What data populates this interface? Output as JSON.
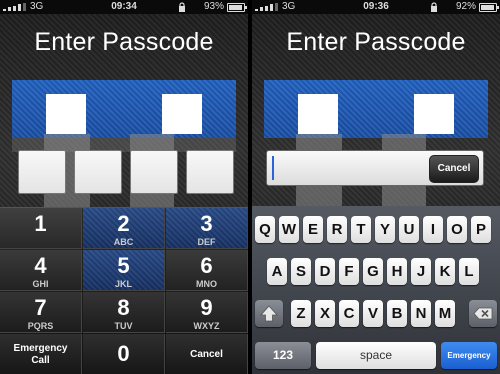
{
  "colors": {
    "accent_blue": "#1a4fa6",
    "emergency_blue": "#2b6fe0",
    "cursor": "#2b63d8"
  },
  "left": {
    "status": {
      "network": "3G",
      "time": "09:34",
      "battery": "93%",
      "battery_level": 0.93
    },
    "title": "Enter Passcode",
    "passcode_boxes": 4,
    "keypad": [
      {
        "num": "1",
        "sub": ""
      },
      {
        "num": "2",
        "sub": "ABC"
      },
      {
        "num": "3",
        "sub": "DEF"
      },
      {
        "num": "4",
        "sub": "GHI"
      },
      {
        "num": "5",
        "sub": "JKL"
      },
      {
        "num": "6",
        "sub": "MNO"
      },
      {
        "num": "7",
        "sub": "PQRS"
      },
      {
        "num": "8",
        "sub": "TUV"
      },
      {
        "num": "9",
        "sub": "WXYZ"
      },
      {
        "label": "Emergency Call"
      },
      {
        "num": "0",
        "sub": ""
      },
      {
        "label": "Cancel"
      }
    ]
  },
  "right": {
    "status": {
      "network": "3G",
      "time": "09:36",
      "battery": "92%",
      "battery_level": 0.92
    },
    "title": "Enter Passcode",
    "input": {
      "value": "",
      "cancel_label": "Cancel"
    },
    "keyboard": {
      "row1": [
        "Q",
        "W",
        "E",
        "R",
        "T",
        "Y",
        "U",
        "I",
        "O",
        "P"
      ],
      "row2": [
        "A",
        "S",
        "D",
        "F",
        "G",
        "H",
        "J",
        "K",
        "L"
      ],
      "row3": [
        "Z",
        "X",
        "C",
        "V",
        "B",
        "N",
        "M"
      ],
      "numbers_label": "123",
      "space_label": "space",
      "emergency_label": "Emergency Call",
      "shift_icon": "shift-arrow-icon",
      "delete_icon": "backspace-icon"
    }
  }
}
